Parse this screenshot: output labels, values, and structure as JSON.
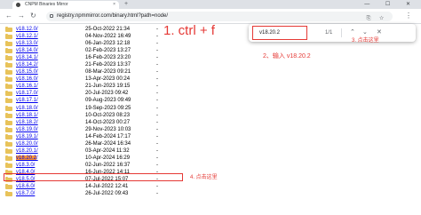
{
  "browser": {
    "tab_title": "CNPM Binaries Mirror",
    "tab_close": "×",
    "new_tab": "+",
    "window_controls": "— ☐ ✕",
    "url": "registry.npmmirror.com/binary.html?path=node/",
    "back_icon": "←",
    "forward_icon": "→",
    "reload_icon": "↻",
    "omnibox_icons": "⎘ ☆",
    "menu_icon": "⋮"
  },
  "listing": [
    {
      "name": "v18.12.0/",
      "date": "25-Oct-2022 21:34",
      "size": "-"
    },
    {
      "name": "v18.12.1/",
      "date": "04-Nov-2022 16:49",
      "size": "-"
    },
    {
      "name": "v18.13.0/",
      "date": "06-Jan-2023 12:18",
      "size": "-"
    },
    {
      "name": "v18.14.0/",
      "date": "02-Feb-2023 13:27",
      "size": "-"
    },
    {
      "name": "v18.14.1/",
      "date": "16-Feb-2023 23:20",
      "size": "-"
    },
    {
      "name": "v18.14.2/",
      "date": "21-Feb-2023 13:37",
      "size": "-"
    },
    {
      "name": "v18.15.0/",
      "date": "08-Mar-2023 09:21",
      "size": "-"
    },
    {
      "name": "v18.16.0/",
      "date": "13-Apr-2023 00:24",
      "size": "-"
    },
    {
      "name": "v18.16.1/",
      "date": "21-Jun-2023 19:15",
      "size": "-"
    },
    {
      "name": "v18.17.0/",
      "date": "20-Jul-2023 09:42",
      "size": "-"
    },
    {
      "name": "v18.17.1/",
      "date": "09-Aug-2023 09:49",
      "size": "-"
    },
    {
      "name": "v18.18.0/",
      "date": "19-Sep-2023 09:25",
      "size": "-"
    },
    {
      "name": "v18.18.1/",
      "date": "10-Oct-2023 08:23",
      "size": "-"
    },
    {
      "name": "v18.18.2/",
      "date": "14-Oct-2023 00:27",
      "size": "-"
    },
    {
      "name": "v18.19.0/",
      "date": "29-Nov-2023 10:03",
      "size": "-"
    },
    {
      "name": "v18.19.1/",
      "date": "14-Feb-2024 17:17",
      "size": "-"
    },
    {
      "name": "v18.20.0/",
      "date": "26-Mar-2024 16:34",
      "size": "-"
    },
    {
      "name": "v18.20.1/",
      "date": "03-Apr-2024 11:32",
      "size": "-"
    },
    {
      "name": "v18.20.2",
      "name_suffix": "/",
      "date": "10-Apr-2024 16:29",
      "size": "-",
      "highlighted": true
    },
    {
      "name": "v18.3.0/",
      "date": "02-Jun-2022 16:37",
      "size": "-"
    },
    {
      "name": "v18.4.0/",
      "date": "16-Jun-2022 14:11",
      "size": "-"
    },
    {
      "name": "v18.5.0/",
      "date": "07-Jul-2022 15:07",
      "size": "-"
    },
    {
      "name": "v18.6.0/",
      "date": "14-Jul-2022 12:41",
      "size": "-"
    },
    {
      "name": "v18.7.0/",
      "date": "26-Jul-2022 09:43",
      "size": "-"
    }
  ],
  "findbar": {
    "value": "v18.20.2",
    "count": "1/1",
    "prev_icon": "⌃",
    "next_icon": "⌄",
    "close_icon": "✕"
  },
  "annotations": {
    "step1": "1. ctrl + f",
    "step2": "2、输入 v18.20.2",
    "step3": "3. 点击这里",
    "step4": "4. 点击这里",
    "color": "#e53935"
  }
}
